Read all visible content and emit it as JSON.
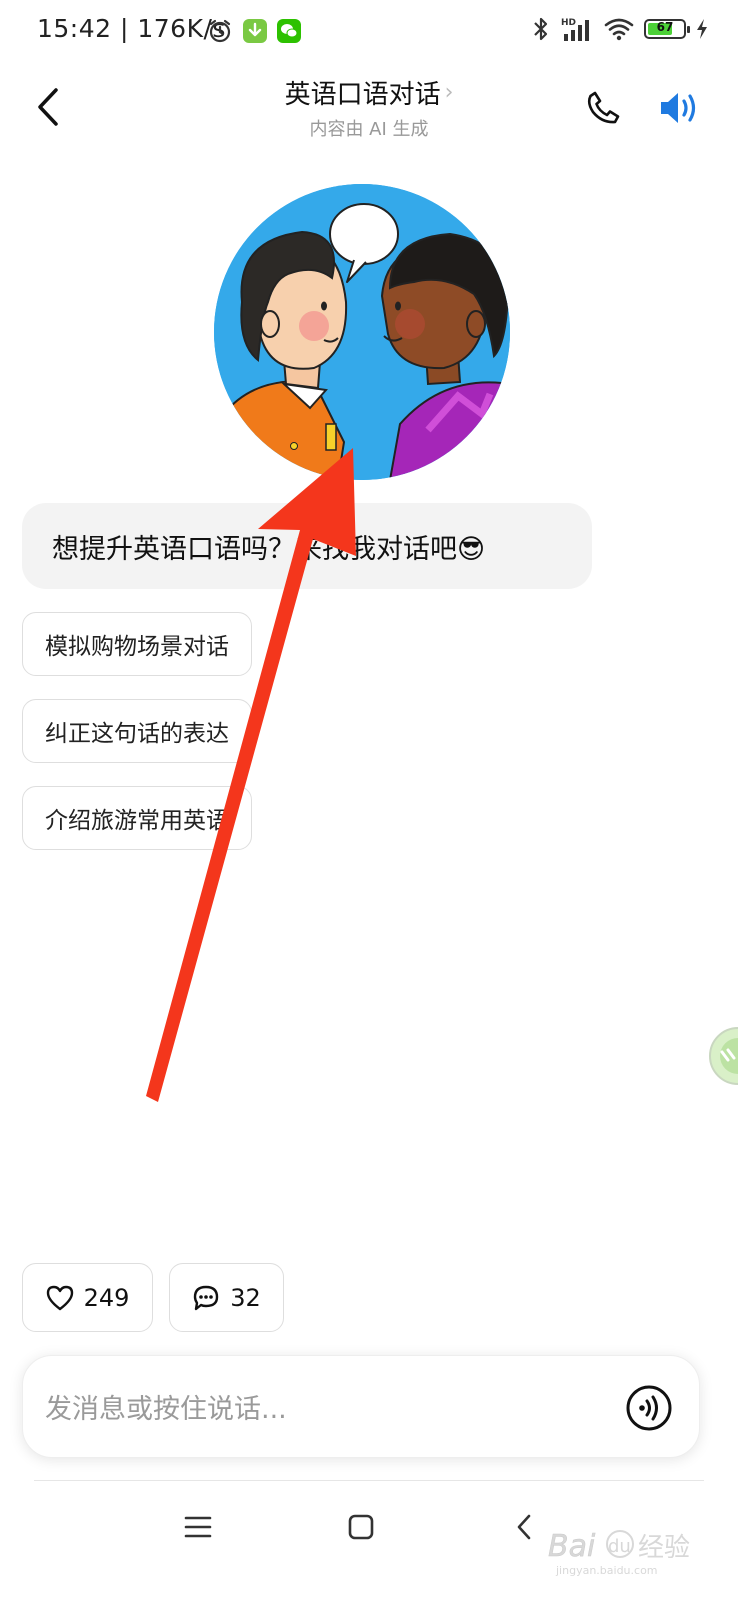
{
  "status_bar": {
    "time": "15:42 | 176K/s",
    "battery": "67",
    "network_label": "HD"
  },
  "header": {
    "title": "英语口语对话",
    "title_chevron": "›",
    "subtitle": "内容由 AI 生成"
  },
  "greeting": "想提升英语口语吗？来找我对话吧😎",
  "suggestions": [
    "模拟购物场景对话",
    "纠正这句话的表达",
    "介绍旅游常用英语"
  ],
  "stats": {
    "likes": "249",
    "comments": "32"
  },
  "input": {
    "placeholder": "发消息或按住说话..."
  },
  "colors": {
    "accent_blue": "#1f7ae0",
    "avatar_bg": "#34a9ea",
    "arrow_red": "#f4361c"
  },
  "icons": {
    "back": "back-icon",
    "phone": "phone-icon",
    "speaker": "speaker-icon",
    "heart": "heart-icon",
    "comment": "comment-icon",
    "voice": "voice-icon"
  }
}
